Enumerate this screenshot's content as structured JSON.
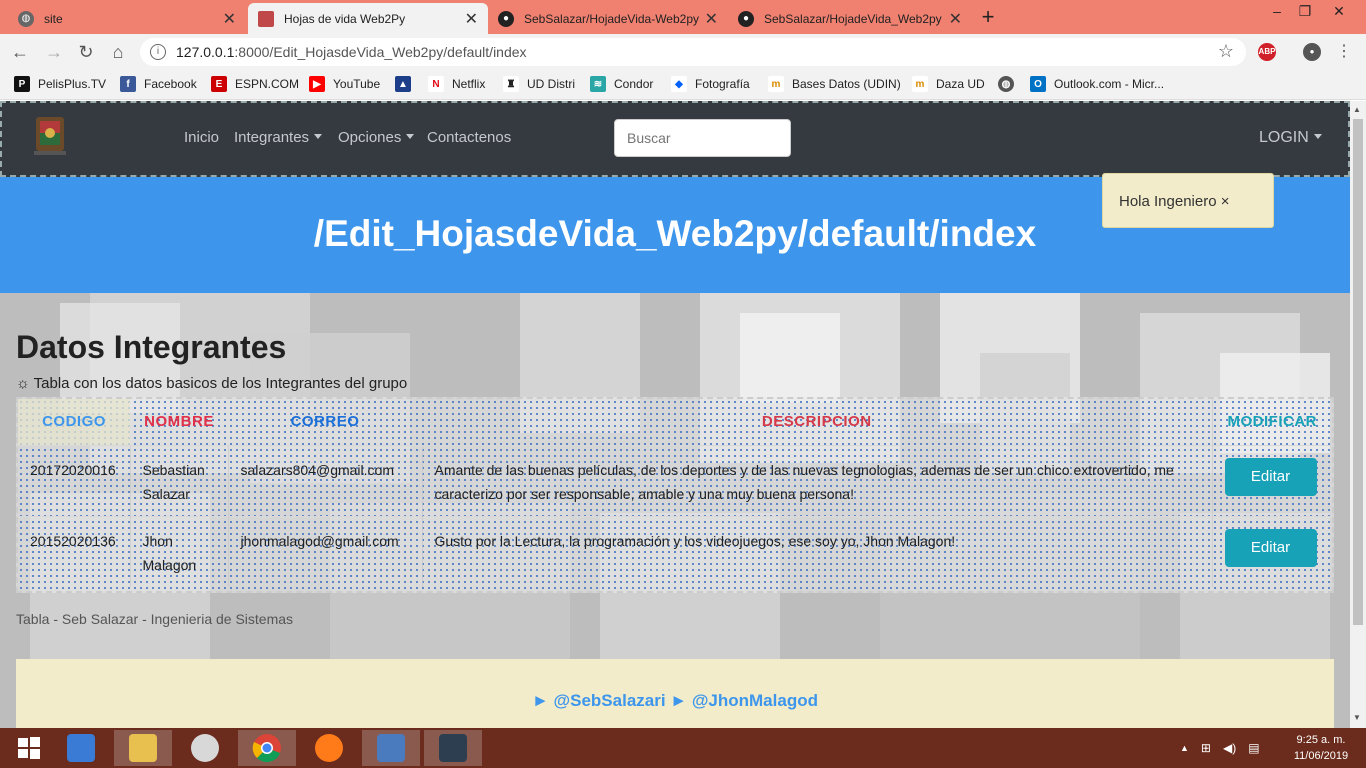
{
  "browser": {
    "tabs": [
      {
        "label": "site",
        "active": false
      },
      {
        "label": "Hojas de vida Web2Py",
        "active": true
      },
      {
        "label": "SebSalazar/HojadeVida-Web2py",
        "active": false
      },
      {
        "label": "SebSalazar/HojadeVida_Web2py",
        "active": false
      }
    ],
    "url_host": "127.0.0.1",
    "url_rest": ":8000/Edit_HojasdeVida_Web2py/default/index",
    "bookmarks": [
      {
        "label": "PelisPlus.TV",
        "icon": "pelisplus-icon",
        "color": "#111111"
      },
      {
        "label": "Facebook",
        "icon": "facebook-icon",
        "color": "#3b5998"
      },
      {
        "label": "ESPN.COM",
        "icon": "espn-icon",
        "color": "#cc0000"
      },
      {
        "label": "YouTube",
        "icon": "youtube-icon",
        "color": "#ff0000"
      },
      {
        "label": "",
        "icon": "mountain-icon",
        "color": "#1d3f8a"
      },
      {
        "label": "Netflix",
        "icon": "netflix-icon",
        "color": "#e50914"
      },
      {
        "label": "UD Distri",
        "icon": "ud-icon",
        "color": "#222222"
      },
      {
        "label": "Condor",
        "icon": "condor-icon",
        "color": "#2aa6a6"
      },
      {
        "label": "Fotografía",
        "icon": "dropbox-icon",
        "color": "#0061fe"
      },
      {
        "label": "Bases Datos (UDIN)",
        "icon": "udin-icon",
        "color": "#d88a00"
      },
      {
        "label": "Daza UD",
        "icon": "udin-icon",
        "color": "#d88a00"
      },
      {
        "label": "",
        "icon": "globe-icon",
        "color": "#555555"
      },
      {
        "label": "Outlook.com - Micr...",
        "icon": "outlook-icon",
        "color": "#0072c6"
      }
    ]
  },
  "nav": {
    "links": [
      "Inicio",
      "Integrantes",
      "Opciones",
      "Contactenos"
    ],
    "search_placeholder": "Buscar",
    "login": "LOGIN"
  },
  "hero": {
    "title": "/Edit_HojasdeVida_Web2py/default/index"
  },
  "flash": {
    "message": "Hola Ingeniero",
    "close": "×"
  },
  "section": {
    "title": "Datos Integrantes",
    "subtitle_icon": "☼",
    "subtitle": "Tabla con los datos basicos de los Integrantes del grupo"
  },
  "table": {
    "headers": [
      {
        "label": "CODIGO",
        "color": "#3d96ec"
      },
      {
        "label": "NOMBRE",
        "color": "#e0304a"
      },
      {
        "label": "CORREO",
        "color": "#1b6fd8"
      },
      {
        "label": "DESCRIPCION",
        "color": "#d43a4a"
      },
      {
        "label": "MODIFICAR",
        "color": "#17a2b8"
      }
    ],
    "rows": [
      {
        "codigo": "20172020016",
        "nombre": "Sebastian Salazar",
        "correo": "salazars804@gmail.com",
        "descripcion": "Amante de las buenas películas, de los deportes y de las nuevas tegnologias, ademas de ser un chico extrovertido, me caracterizo por ser responsable, amable y una muy buena persona!",
        "accion": "Editar"
      },
      {
        "codigo": "20152020136",
        "nombre": "Jhon Malagon",
        "correo": "jhonmalagod@gmail.com",
        "descripcion": "Gusto por la Lectura, la programación y los videojuegos, ese soy yo, Jhon Malagon!",
        "accion": "Editar"
      }
    ],
    "footer": "Tabla - Seb Salazar - Ingenieria de Sistemas"
  },
  "footer": {
    "links": "► @SebSalazari ► @JhonMalagod"
  },
  "taskbar": {
    "apps": [
      "start-icon",
      "this-pc-icon",
      "file-explorer-icon",
      "snipping-tool-icon",
      "chrome-icon",
      "firefox-icon",
      "python-launcher-icon",
      "python-idle-icon"
    ],
    "time": "9:25 a. m.",
    "date": "11/06/2019"
  }
}
